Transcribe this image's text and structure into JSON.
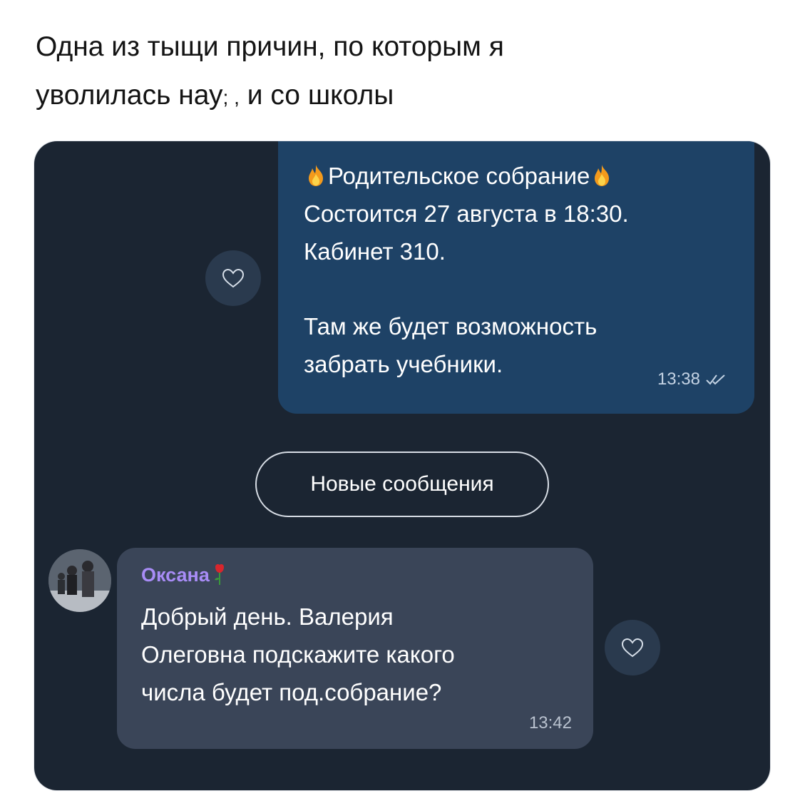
{
  "post": {
    "caption_line1": "Одна из тыщи причин, по которым я",
    "caption_line2": "уволилась нау",
    "caption_line2_glyphs": "; ,",
    "caption_line2_end": "и со школы"
  },
  "chat": {
    "background": "#1b2532",
    "outgoing": {
      "bubble_color": "#1e4266",
      "title": "Родительское собрание",
      "title_icon": "fire-emoji",
      "line2": "Состоится 27 августа в 18:30.",
      "line3": "Кабинет 310.",
      "line4": "Там же будет возможность",
      "line5": "забрать учебники.",
      "time": "13:38",
      "status_icon": "double-check-icon"
    },
    "new_messages_label": "Новые сообщения",
    "incoming": {
      "bubble_color": "#3a4558",
      "sender": "Оксана",
      "sender_color": "#a88cf6",
      "sender_icon": "rose-emoji",
      "line1": "Добрый день. Валерия",
      "line2": "Олеговна подскажите какого",
      "line3": "числа будет под.собрание?",
      "time": "13:42"
    },
    "reaction_icon": "heart-outline-icon"
  }
}
